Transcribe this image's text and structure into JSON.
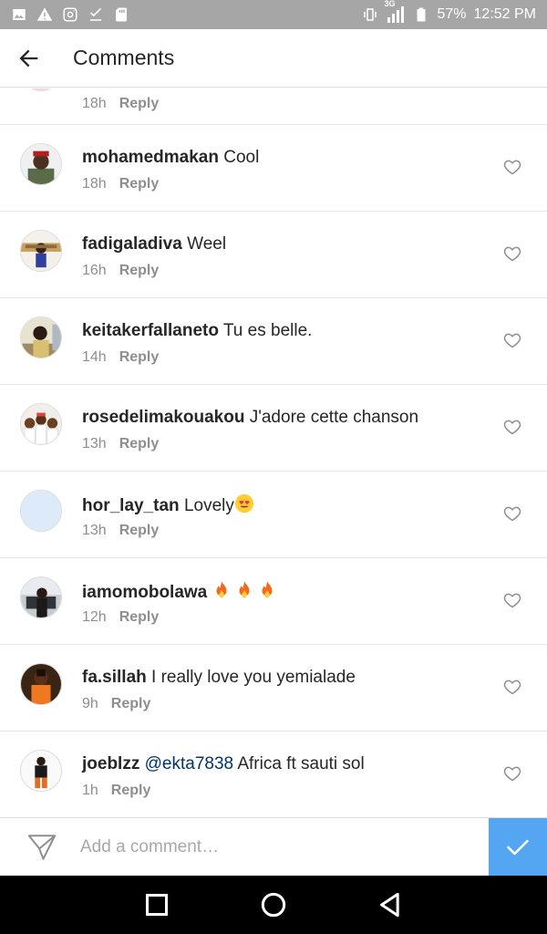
{
  "status_bar": {
    "battery": "57%",
    "time": "12:52 PM",
    "network": "3G"
  },
  "header": {
    "title": "Comments",
    "back_icon": "arrow-left-icon"
  },
  "top_partial": {
    "time": "18h",
    "reply_label": "Reply"
  },
  "comments": [
    {
      "username": "mohamedmakan",
      "text": "Cool",
      "time": "18h",
      "reply_label": "Reply"
    },
    {
      "username": "fadigaladiva",
      "text": "Weel",
      "time": "16h",
      "reply_label": "Reply"
    },
    {
      "username": "keitakerfallaneto",
      "text": "Tu es belle.",
      "time": "14h",
      "reply_label": "Reply"
    },
    {
      "username": "rosedelimakouakou",
      "text": "J'adore cette chanson",
      "time": "13h",
      "reply_label": "Reply"
    },
    {
      "username": "hor_lay_tan",
      "text": "Lovely",
      "time": "13h",
      "reply_label": "Reply"
    },
    {
      "username": "iamomobolawa",
      "text": "",
      "time": "12h",
      "reply_label": "Reply"
    },
    {
      "username": "fa.sillah",
      "text": "I really love you yemialade",
      "time": "9h",
      "reply_label": "Reply"
    },
    {
      "username": "joeblzz",
      "mention": "@ekta7838",
      "text": "Africa ft sauti sol",
      "time": "1h",
      "reply_label": "Reply"
    }
  ],
  "composer": {
    "placeholder": "Add a comment…"
  },
  "colors": {
    "status_bar": "#a6a6a6",
    "post_button": "#3897f0",
    "mention": "#003569",
    "secondary_text": "#8e8e8e"
  }
}
